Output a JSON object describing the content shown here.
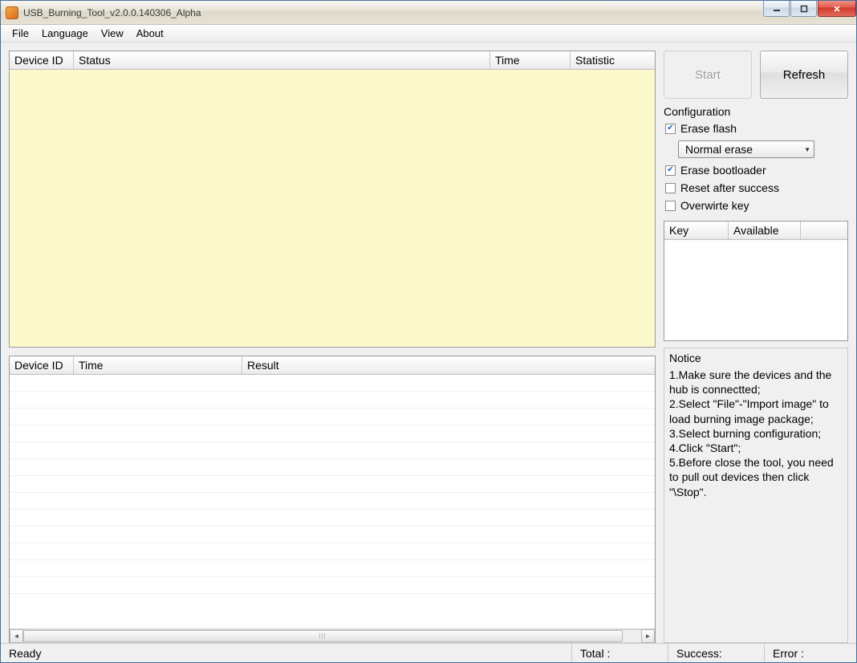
{
  "window": {
    "title": "USB_Burning_Tool_v2.0.0.140306_Alpha"
  },
  "menu": {
    "file": "File",
    "language": "Language",
    "view": "View",
    "about": "About"
  },
  "top_table": {
    "cols": {
      "device_id": "Device ID",
      "status": "Status",
      "time": "Time",
      "statistic": "Statistic"
    }
  },
  "bottom_table": {
    "cols": {
      "device_id": "Device ID",
      "time": "Time",
      "result": "Result"
    }
  },
  "buttons": {
    "start": "Start",
    "refresh": "Refresh"
  },
  "config": {
    "title": "Configuration",
    "erase_flash": {
      "label": "Erase flash",
      "checked": true
    },
    "erase_mode": {
      "selected": "Normal erase"
    },
    "erase_bootloader": {
      "label": "Erase bootloader",
      "checked": true
    },
    "reset_after_success": {
      "label": "Reset after success",
      "checked": false
    },
    "overwrite_key": {
      "label": "Overwirte key",
      "checked": false
    }
  },
  "key_table": {
    "cols": {
      "key": "Key",
      "available": "Available"
    }
  },
  "notice": {
    "title": "Notice",
    "body": "1.Make sure the devices and the hub is connectted;\n2.Select \"File\"-\"Import image\" to load burning image package;\n3.Select burning configuration;\n4.Click \"Start\";\n5.Before close the tool, you need to pull out devices then click \"\\Stop\"."
  },
  "status": {
    "ready": "Ready",
    "total": "Total :",
    "success": "Success:",
    "error": "Error :"
  }
}
